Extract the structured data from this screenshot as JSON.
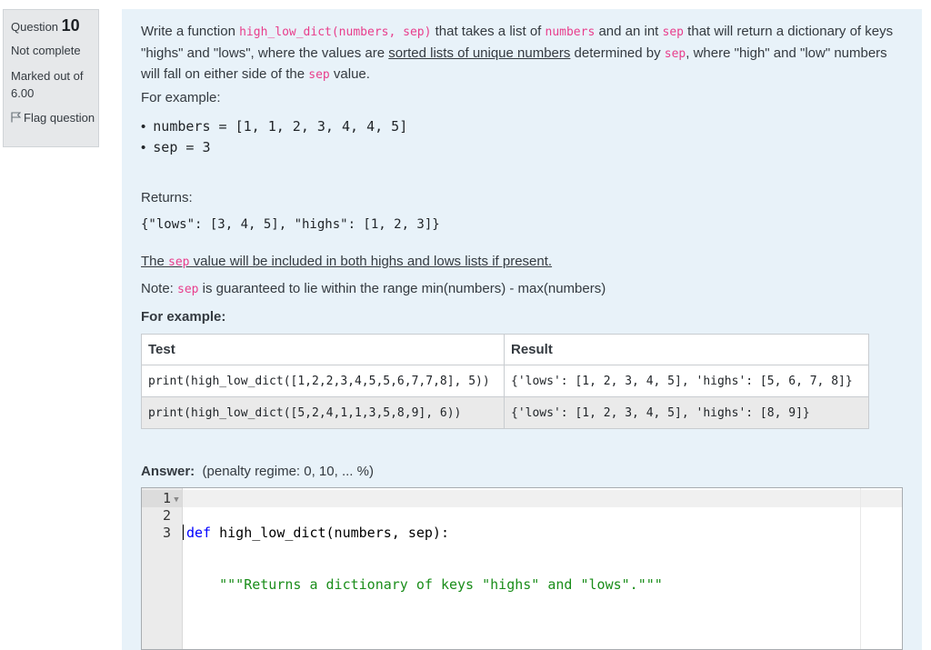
{
  "info": {
    "question_label": "Question",
    "question_number": "10",
    "state": "Not complete",
    "marks": "Marked out of 6.00",
    "flag_label": "Flag question"
  },
  "question": {
    "p1_a": "Write a function ",
    "p1_code1": "high_low_dict(numbers, sep)",
    "p1_b": " that takes a list of ",
    "p1_code2": "numbers",
    "p1_c": " and an int ",
    "p1_code3": "sep",
    "p1_d": " that will return a dictionary of keys \"highs\" and \"lows\", where the values are ",
    "p1_link": "sorted lists of unique numbers",
    "p1_e": " determined by ",
    "p1_code4": "sep",
    "p1_f": ", where \"high\" and \"low\" numbers will fall on either side of the ",
    "p1_code5": "sep",
    "p1_g": " value.",
    "for_example": "For example:",
    "example_items": [
      "numbers = [1, 1, 2, 3, 4, 4, 5]",
      "sep = 3"
    ],
    "returns_label": "Returns:",
    "returns_value": "{\"lows\": [3, 4, 5], \"highs\": [1, 2, 3]}",
    "sep_note_a": "The ",
    "sep_note_code": "sep",
    "sep_note_b": " value will be included in both highs and lows lists if present.",
    "note_a": "Note: ",
    "note_code": "sep",
    "note_b": " is guaranteed to lie within the range min(numbers) - max(numbers)",
    "for_example_bold": "For example:"
  },
  "tests": {
    "headers": [
      "Test",
      "Result"
    ],
    "rows": [
      [
        "print(high_low_dict([1,2,2,3,4,5,5,6,7,7,8], 5))",
        "{'lows': [1, 2, 3, 4, 5], 'highs': [5, 6, 7, 8]}"
      ],
      [
        "print(high_low_dict([5,2,4,1,1,3,5,8,9], 6))",
        "{'lows': [1, 2, 3, 4, 5], 'highs': [8, 9]}"
      ]
    ]
  },
  "answer": {
    "label": "Answer:",
    "penalty": "(penalty regime: 0, 10, ... %)"
  },
  "editor": {
    "line_numbers": [
      "1",
      "2",
      "3"
    ],
    "line1_kw": "def",
    "line1_rest": " high_low_dict(numbers, sep):",
    "line2_indent": "    ",
    "line2_str": "\"\"\"Returns a dictionary of keys \"highs\" and \"lows\".\"\"\"",
    "line3": ""
  }
}
